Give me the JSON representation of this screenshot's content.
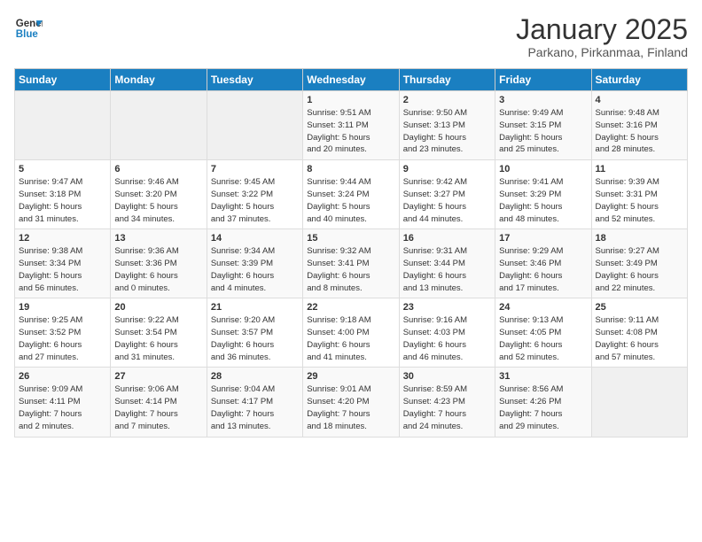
{
  "logo": {
    "line1": "General",
    "line2": "Blue"
  },
  "title": "January 2025",
  "subtitle": "Parkano, Pirkanmaa, Finland",
  "days_of_week": [
    "Sunday",
    "Monday",
    "Tuesday",
    "Wednesday",
    "Thursday",
    "Friday",
    "Saturday"
  ],
  "weeks": [
    [
      {
        "day": "",
        "info": ""
      },
      {
        "day": "",
        "info": ""
      },
      {
        "day": "",
        "info": ""
      },
      {
        "day": "1",
        "info": "Sunrise: 9:51 AM\nSunset: 3:11 PM\nDaylight: 5 hours\nand 20 minutes."
      },
      {
        "day": "2",
        "info": "Sunrise: 9:50 AM\nSunset: 3:13 PM\nDaylight: 5 hours\nand 23 minutes."
      },
      {
        "day": "3",
        "info": "Sunrise: 9:49 AM\nSunset: 3:15 PM\nDaylight: 5 hours\nand 25 minutes."
      },
      {
        "day": "4",
        "info": "Sunrise: 9:48 AM\nSunset: 3:16 PM\nDaylight: 5 hours\nand 28 minutes."
      }
    ],
    [
      {
        "day": "5",
        "info": "Sunrise: 9:47 AM\nSunset: 3:18 PM\nDaylight: 5 hours\nand 31 minutes."
      },
      {
        "day": "6",
        "info": "Sunrise: 9:46 AM\nSunset: 3:20 PM\nDaylight: 5 hours\nand 34 minutes."
      },
      {
        "day": "7",
        "info": "Sunrise: 9:45 AM\nSunset: 3:22 PM\nDaylight: 5 hours\nand 37 minutes."
      },
      {
        "day": "8",
        "info": "Sunrise: 9:44 AM\nSunset: 3:24 PM\nDaylight: 5 hours\nand 40 minutes."
      },
      {
        "day": "9",
        "info": "Sunrise: 9:42 AM\nSunset: 3:27 PM\nDaylight: 5 hours\nand 44 minutes."
      },
      {
        "day": "10",
        "info": "Sunrise: 9:41 AM\nSunset: 3:29 PM\nDaylight: 5 hours\nand 48 minutes."
      },
      {
        "day": "11",
        "info": "Sunrise: 9:39 AM\nSunset: 3:31 PM\nDaylight: 5 hours\nand 52 minutes."
      }
    ],
    [
      {
        "day": "12",
        "info": "Sunrise: 9:38 AM\nSunset: 3:34 PM\nDaylight: 5 hours\nand 56 minutes."
      },
      {
        "day": "13",
        "info": "Sunrise: 9:36 AM\nSunset: 3:36 PM\nDaylight: 6 hours\nand 0 minutes."
      },
      {
        "day": "14",
        "info": "Sunrise: 9:34 AM\nSunset: 3:39 PM\nDaylight: 6 hours\nand 4 minutes."
      },
      {
        "day": "15",
        "info": "Sunrise: 9:32 AM\nSunset: 3:41 PM\nDaylight: 6 hours\nand 8 minutes."
      },
      {
        "day": "16",
        "info": "Sunrise: 9:31 AM\nSunset: 3:44 PM\nDaylight: 6 hours\nand 13 minutes."
      },
      {
        "day": "17",
        "info": "Sunrise: 9:29 AM\nSunset: 3:46 PM\nDaylight: 6 hours\nand 17 minutes."
      },
      {
        "day": "18",
        "info": "Sunrise: 9:27 AM\nSunset: 3:49 PM\nDaylight: 6 hours\nand 22 minutes."
      }
    ],
    [
      {
        "day": "19",
        "info": "Sunrise: 9:25 AM\nSunset: 3:52 PM\nDaylight: 6 hours\nand 27 minutes."
      },
      {
        "day": "20",
        "info": "Sunrise: 9:22 AM\nSunset: 3:54 PM\nDaylight: 6 hours\nand 31 minutes."
      },
      {
        "day": "21",
        "info": "Sunrise: 9:20 AM\nSunset: 3:57 PM\nDaylight: 6 hours\nand 36 minutes."
      },
      {
        "day": "22",
        "info": "Sunrise: 9:18 AM\nSunset: 4:00 PM\nDaylight: 6 hours\nand 41 minutes."
      },
      {
        "day": "23",
        "info": "Sunrise: 9:16 AM\nSunset: 4:03 PM\nDaylight: 6 hours\nand 46 minutes."
      },
      {
        "day": "24",
        "info": "Sunrise: 9:13 AM\nSunset: 4:05 PM\nDaylight: 6 hours\nand 52 minutes."
      },
      {
        "day": "25",
        "info": "Sunrise: 9:11 AM\nSunset: 4:08 PM\nDaylight: 6 hours\nand 57 minutes."
      }
    ],
    [
      {
        "day": "26",
        "info": "Sunrise: 9:09 AM\nSunset: 4:11 PM\nDaylight: 7 hours\nand 2 minutes."
      },
      {
        "day": "27",
        "info": "Sunrise: 9:06 AM\nSunset: 4:14 PM\nDaylight: 7 hours\nand 7 minutes."
      },
      {
        "day": "28",
        "info": "Sunrise: 9:04 AM\nSunset: 4:17 PM\nDaylight: 7 hours\nand 13 minutes."
      },
      {
        "day": "29",
        "info": "Sunrise: 9:01 AM\nSunset: 4:20 PM\nDaylight: 7 hours\nand 18 minutes."
      },
      {
        "day": "30",
        "info": "Sunrise: 8:59 AM\nSunset: 4:23 PM\nDaylight: 7 hours\nand 24 minutes."
      },
      {
        "day": "31",
        "info": "Sunrise: 8:56 AM\nSunset: 4:26 PM\nDaylight: 7 hours\nand 29 minutes."
      },
      {
        "day": "",
        "info": ""
      }
    ]
  ]
}
